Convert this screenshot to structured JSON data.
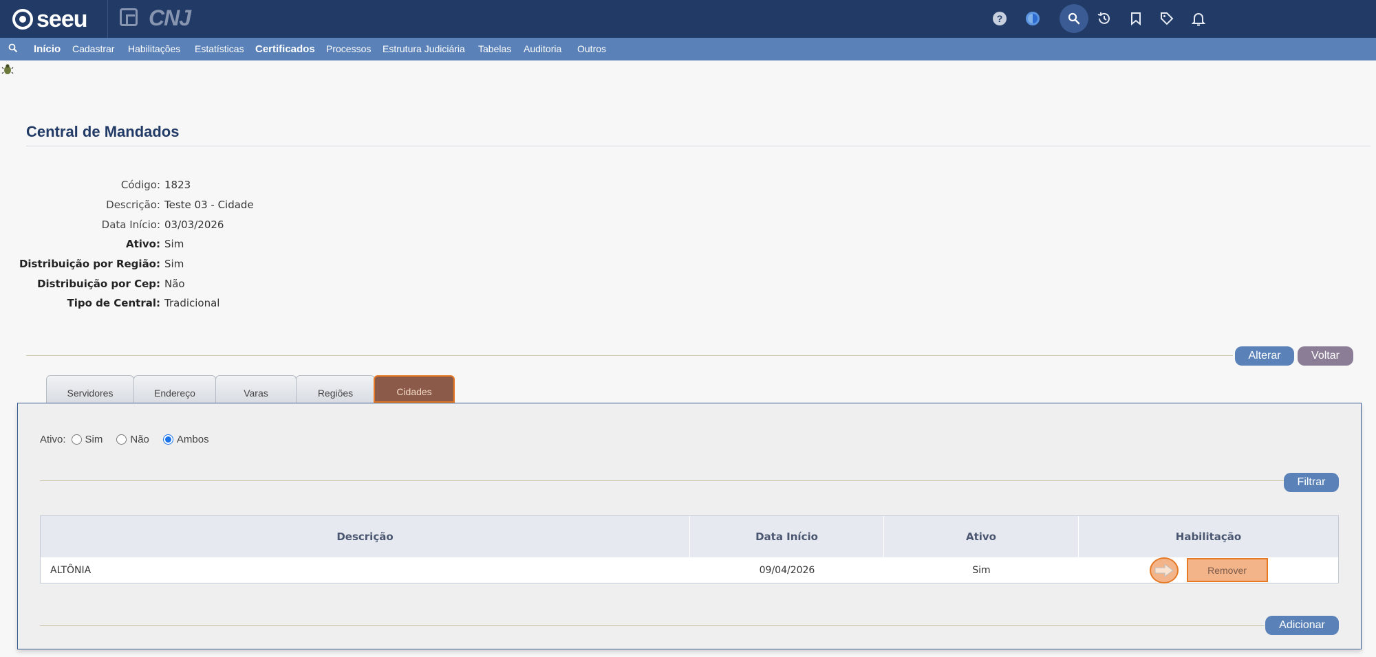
{
  "header": {
    "logo_text": "seeu",
    "cnj_text": "CNJ"
  },
  "menu": {
    "items": [
      "Início",
      "Cadastrar",
      "Habilitações",
      "Estatísticas",
      "Certificados",
      "Processos",
      "Estrutura Judiciária",
      "Tabelas",
      "Auditoria",
      "Outros"
    ]
  },
  "page": {
    "title": "Central de Mandados"
  },
  "details": [
    {
      "label": "Código:",
      "value": "1823"
    },
    {
      "label": "Descrição:",
      "value": "Teste 03 - Cidade"
    },
    {
      "label": "Data Início:",
      "value": "03/03/2026"
    },
    {
      "label": "Ativo:",
      "value": "Sim"
    },
    {
      "label": "Distribuição por Região:",
      "value": "Sim"
    },
    {
      "label": "Distribuição por Cep:",
      "value": "Não"
    },
    {
      "label": "Tipo de Central:",
      "value": "Tradicional"
    }
  ],
  "actions": {
    "alterar": "Alterar",
    "voltar": "Voltar"
  },
  "tabs": [
    "Servidores",
    "Endereço",
    "Varas",
    "Regiões",
    "Cidades"
  ],
  "active_tab": "Cidades",
  "filter": {
    "label": "Ativo:",
    "options": [
      "Sim",
      "Não",
      "Ambos"
    ],
    "selected": "Ambos",
    "button": "Filtrar"
  },
  "table": {
    "headers": [
      "Descrição",
      "Data Início",
      "Ativo",
      "Habilitação"
    ],
    "rows": [
      {
        "descricao": "ALTÔNIA",
        "data_inicio": "09/04/2026",
        "ativo": "Sim",
        "action": "Remover"
      }
    ]
  },
  "add_button": "Adicionar",
  "colors": {
    "header_bg": "#213a66",
    "menu_bg": "#5a82b8",
    "active_tab": "#8c5a48",
    "highlight": "#e67a24"
  }
}
